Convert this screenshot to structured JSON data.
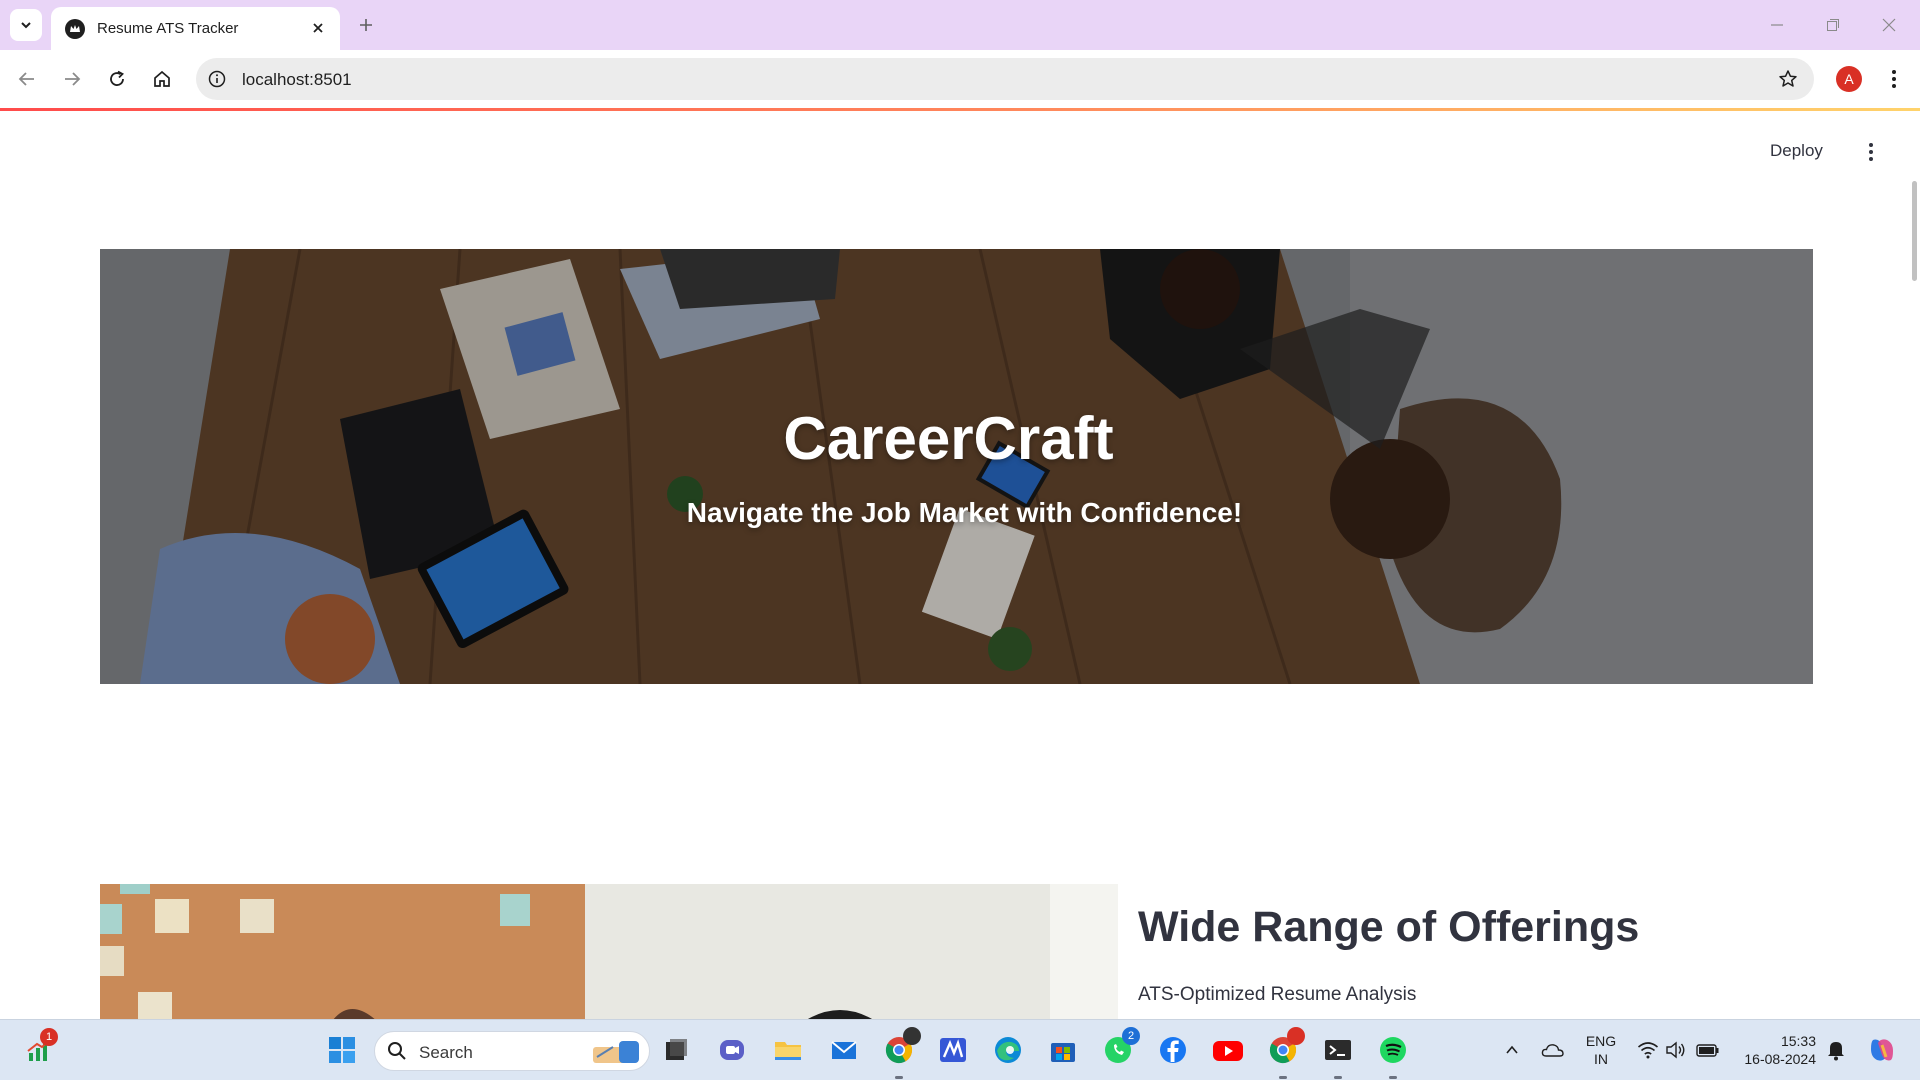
{
  "browser": {
    "tab_title": "Resume ATS Tracker",
    "url": "localhost:8501",
    "profile_initial": "A",
    "accent_color": "#e9d5f7"
  },
  "app": {
    "deploy_label": "Deploy",
    "hero": {
      "title": "CareerCraft",
      "subtitle": "Navigate the Job Market with Confidence!"
    },
    "offerings": {
      "heading": "Wide Range of Offerings",
      "items": [
        "ATS-Optimized Resume Analysis"
      ]
    }
  },
  "taskbar": {
    "search_placeholder": "Search",
    "stocks_badge": "1",
    "whatsapp_badge": "2",
    "language_line1": "ENG",
    "language_line2": "IN",
    "time": "15:33",
    "date": "16-08-2024"
  }
}
